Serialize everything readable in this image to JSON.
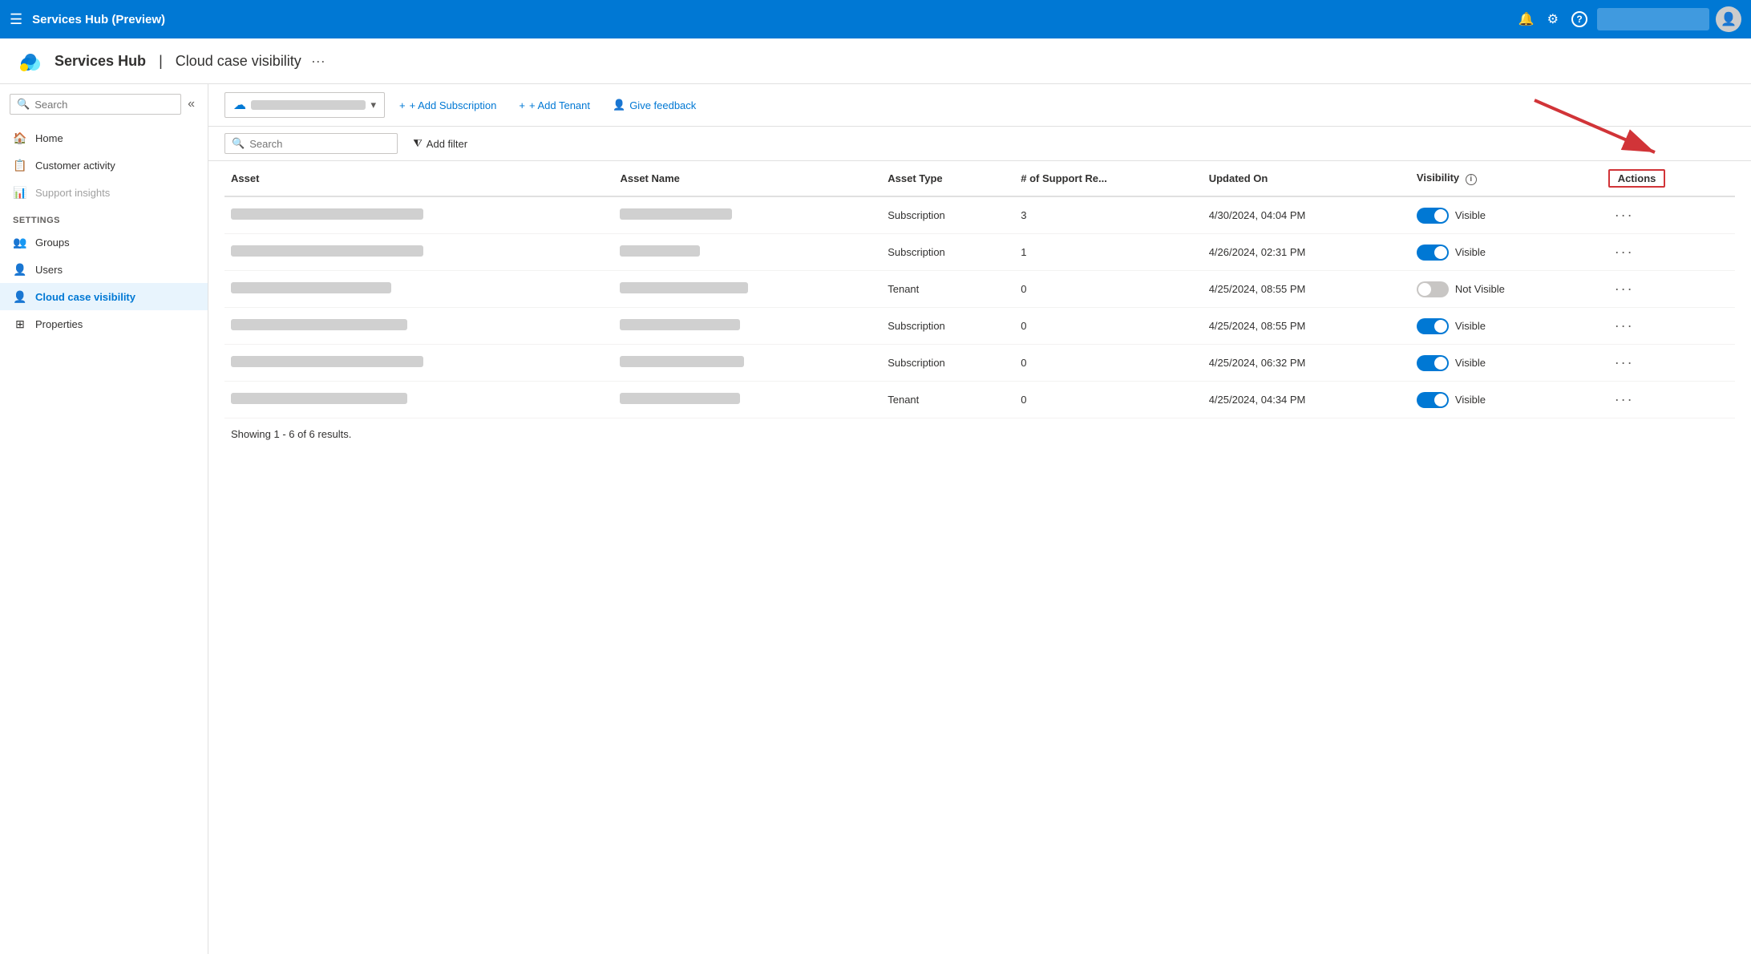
{
  "topbar": {
    "title": "Services Hub (Preview)",
    "email_placeholder": "@",
    "icons": {
      "bell": "🔔",
      "gear": "⚙",
      "help": "?"
    }
  },
  "page_header": {
    "brand": "Services Hub",
    "divider": "|",
    "page_name": "Cloud case visibility",
    "more_label": "···"
  },
  "sidebar": {
    "search_placeholder": "Search",
    "collapse_icon": "«",
    "nav_items": [
      {
        "id": "home",
        "label": "Home",
        "icon": "🏠"
      },
      {
        "id": "customer-activity",
        "label": "Customer activity",
        "icon": "📋"
      },
      {
        "id": "support-insights",
        "label": "Support insights",
        "icon": "📊"
      }
    ],
    "settings_label": "Settings",
    "settings_items": [
      {
        "id": "groups",
        "label": "Groups",
        "icon": "👥"
      },
      {
        "id": "users",
        "label": "Users",
        "icon": "👤"
      },
      {
        "id": "cloud-case-visibility",
        "label": "Cloud case visibility",
        "icon": "👤",
        "active": true
      },
      {
        "id": "properties",
        "label": "Properties",
        "icon": "⊞"
      }
    ]
  },
  "toolbar": {
    "subscription_placeholder": "Subscription dropdown",
    "subscription_dropdown_arrow": "▾",
    "add_subscription_label": "+ Add Subscription",
    "add_tenant_label": "+ Add Tenant",
    "give_feedback_label": "Give feedback"
  },
  "filter_bar": {
    "search_placeholder": "Search",
    "add_filter_label": "Add filter"
  },
  "table": {
    "columns": {
      "asset": "Asset",
      "asset_name": "Asset Name",
      "asset_type": "Asset Type",
      "support_requests": "# of Support Re...",
      "updated_on": "Updated On",
      "visibility": "Visibility",
      "actions": "Actions"
    },
    "rows": [
      {
        "asset_width": 240,
        "asset_name_width": 140,
        "asset_type": "Subscription",
        "support_requests": "3",
        "updated_on": "4/30/2024, 04:04 PM",
        "visible": true,
        "visibility_label": "Visible"
      },
      {
        "asset_width": 240,
        "asset_name_width": 100,
        "asset_type": "Subscription",
        "support_requests": "1",
        "updated_on": "4/26/2024, 02:31 PM",
        "visible": true,
        "visibility_label": "Visible"
      },
      {
        "asset_width": 200,
        "asset_name_width": 160,
        "asset_type": "Tenant",
        "support_requests": "0",
        "updated_on": "4/25/2024, 08:55 PM",
        "visible": false,
        "visibility_label": "Not Visible"
      },
      {
        "asset_width": 220,
        "asset_name_width": 150,
        "asset_type": "Subscription",
        "support_requests": "0",
        "updated_on": "4/25/2024, 08:55 PM",
        "visible": true,
        "visibility_label": "Visible"
      },
      {
        "asset_width": 240,
        "asset_name_width": 155,
        "asset_type": "Subscription",
        "support_requests": "0",
        "updated_on": "4/25/2024, 06:32 PM",
        "visible": true,
        "visibility_label": "Visible"
      },
      {
        "asset_width": 220,
        "asset_name_width": 150,
        "asset_type": "Tenant",
        "support_requests": "0",
        "updated_on": "4/25/2024, 04:34 PM",
        "visible": true,
        "visibility_label": "Visible"
      }
    ],
    "results_text": "Showing 1 - 6 of 6 results."
  },
  "arrow": {
    "color": "#d13438"
  }
}
